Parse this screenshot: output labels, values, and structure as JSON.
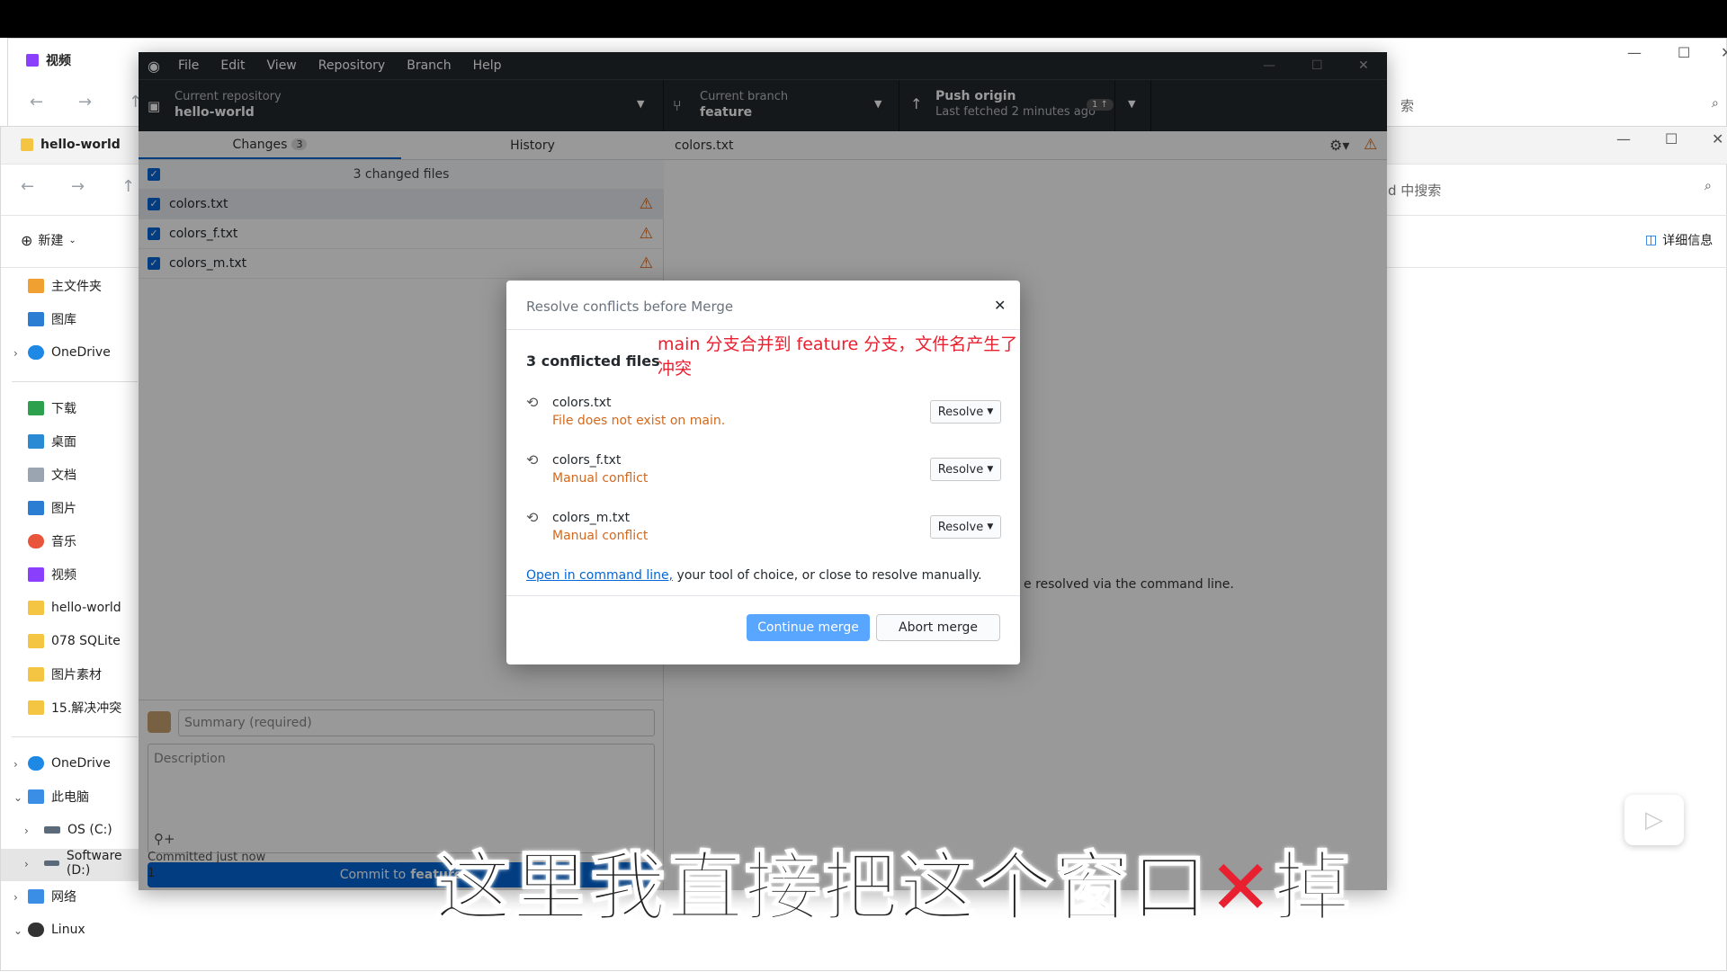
{
  "explorer_back": {
    "tab_title": "视频",
    "search_hint": "索"
  },
  "explorer_front": {
    "tab_title": "hello-world",
    "new_label": "新建",
    "search_hint": "d 中搜索",
    "details_label": "详细信息",
    "sidebar": [
      {
        "label": "主文件夹",
        "icon": "home-icon"
      },
      {
        "label": "图库",
        "icon": "gallery-icon"
      },
      {
        "label": "OneDrive",
        "icon": "cloud-icon"
      },
      {
        "label": "下载",
        "icon": "download-icon"
      },
      {
        "label": "桌面",
        "icon": "desktop-icon"
      },
      {
        "label": "文档",
        "icon": "document-icon"
      },
      {
        "label": "图片",
        "icon": "picture-icon"
      },
      {
        "label": "音乐",
        "icon": "music-icon"
      },
      {
        "label": "视频",
        "icon": "video-icon"
      },
      {
        "label": "hello-world",
        "icon": "folder-icon"
      },
      {
        "label": "078 SQLite",
        "icon": "folder-icon"
      },
      {
        "label": "图片素材",
        "icon": "folder-icon"
      },
      {
        "label": "15.解决冲突",
        "icon": "folder-icon"
      },
      {
        "label": "OneDrive",
        "icon": "cloud-icon"
      },
      {
        "label": "此电脑",
        "icon": "computer-icon"
      },
      {
        "label": "OS (C:)",
        "icon": "drive-icon"
      },
      {
        "label": "Software (D:)",
        "icon": "drive-icon"
      },
      {
        "label": "网络",
        "icon": "network-icon"
      },
      {
        "label": "Linux",
        "icon": "linux-icon"
      }
    ]
  },
  "gh": {
    "menu": [
      "File",
      "Edit",
      "View",
      "Repository",
      "Branch",
      "Help"
    ],
    "repo": {
      "label": "Current repository",
      "value": "hello-world"
    },
    "branch": {
      "label": "Current branch",
      "value": "feature"
    },
    "push": {
      "label": "Push origin",
      "sub": "Last fetched 2 minutes ago",
      "badge": "1 ↑"
    },
    "tabs": {
      "changes": "Changes",
      "changes_count": "3",
      "history": "History"
    },
    "changed_files_label": "3 changed files",
    "files": [
      "colors.txt",
      "colors_f.txt",
      "colors_m.txt"
    ],
    "diff_file": "colors.txt",
    "diff_hint": "e resolved via the command line.",
    "summary_placeholder": "Summary (required)",
    "description_placeholder": "Description",
    "commit_label": "Commit to",
    "commit_branch": "feature",
    "committed_label": "Committed just now",
    "committed_msg": "1"
  },
  "modal": {
    "title": "Resolve conflicts before Merge",
    "annotation": "main 分支合并到 feature 分支，文件名产生了冲突",
    "heading": "3 conflicted files",
    "items": [
      {
        "name": "colors.txt",
        "status": "File does not exist on main."
      },
      {
        "name": "colors_f.txt",
        "status": "Manual conflict"
      },
      {
        "name": "colors_m.txt",
        "status": "Manual conflict"
      }
    ],
    "resolve_label": "Resolve",
    "footer_link": "Open in command line,",
    "footer_text": " your tool of choice, or close to resolve manually.",
    "continue_label": "Continue merge",
    "abort_label": "Abort merge"
  },
  "caption": {
    "before": "这里我直接把这个窗口",
    "after": "掉"
  },
  "colors": {
    "accent": "#0366d6",
    "warning": "#e36209",
    "caption_x": "#e8202f"
  }
}
